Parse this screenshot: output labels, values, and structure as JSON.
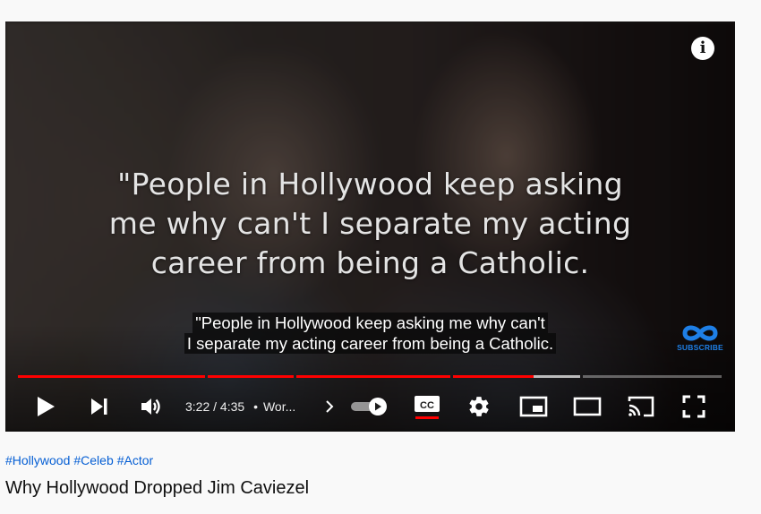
{
  "video": {
    "overlay_quote": [
      "\"People in Hollywood keep asking",
      "me why can't I separate my acting",
      "career from being a Catholic."
    ],
    "captions": [
      "\"People in Hollywood keep asking me why can't",
      "I separate my acting career from being a Catholic."
    ],
    "watermark_text": "SUBSCRIBE",
    "info_icon": "i",
    "progress_played": 0.7418,
    "time_current": "3:22",
    "time_separator": "/",
    "time_total": "4:35",
    "chapter_dot": "•",
    "chapter_label": "Wor...",
    "colors": {
      "progress_played": "#ff0000",
      "watermark": "#1e7fe6",
      "cc_underline": "#ff0000"
    },
    "icons": [
      "play-icon",
      "next-icon",
      "volume-icon",
      "chevron-right-icon",
      "autoplay-toggle-icon",
      "subtitles-icon",
      "settings-gear-icon",
      "miniplayer-icon",
      "theater-mode-icon",
      "cast-icon",
      "fullscreen-icon",
      "info-icon",
      "infinity-logo-icon"
    ]
  },
  "meta": {
    "hashtags": [
      "#Hollywood",
      "#Celeb",
      "#Actor"
    ],
    "title": "Why Hollywood Dropped Jim Caviezel"
  }
}
